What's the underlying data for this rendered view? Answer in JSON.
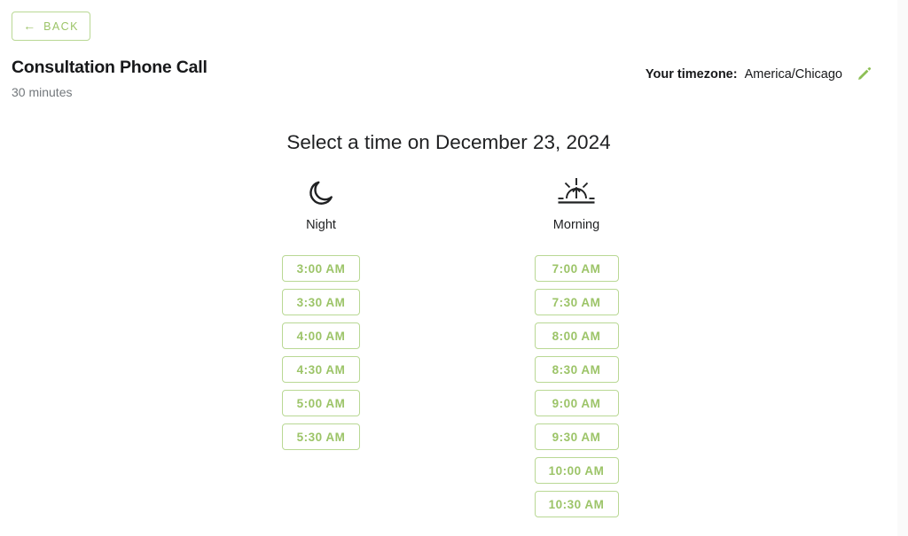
{
  "header": {
    "back_button": {
      "label": "BACK",
      "icon": "arrow-left-icon",
      "glyph": "←"
    },
    "event_title": "Consultation Phone Call",
    "event_duration": "30 minutes",
    "timezone": {
      "label": "Your timezone:",
      "value": "America/Chicago",
      "edit_icon": "pencil-icon"
    }
  },
  "main": {
    "heading": "Select a time on December 23, 2024",
    "columns": [
      {
        "id": "night",
        "label": "Night",
        "icon": "crescent-moon-icon",
        "slots": [
          "3:00 AM",
          "3:30 AM",
          "4:00 AM",
          "4:30 AM",
          "5:00 AM",
          "5:30 AM"
        ]
      },
      {
        "id": "morning",
        "label": "Morning",
        "icon": "sunrise-icon",
        "slots": [
          "7:00 AM",
          "7:30 AM",
          "8:00 AM",
          "8:30 AM",
          "9:00 AM",
          "9:30 AM",
          "10:00 AM",
          "10:30 AM"
        ]
      }
    ]
  },
  "colors": {
    "accent_green": "#9cc468",
    "border_green": "#b9d894",
    "text_dark": "#17181a",
    "text_muted": "#73787c",
    "background": "#ffffff",
    "scrollbar_track": "#fafafa"
  }
}
